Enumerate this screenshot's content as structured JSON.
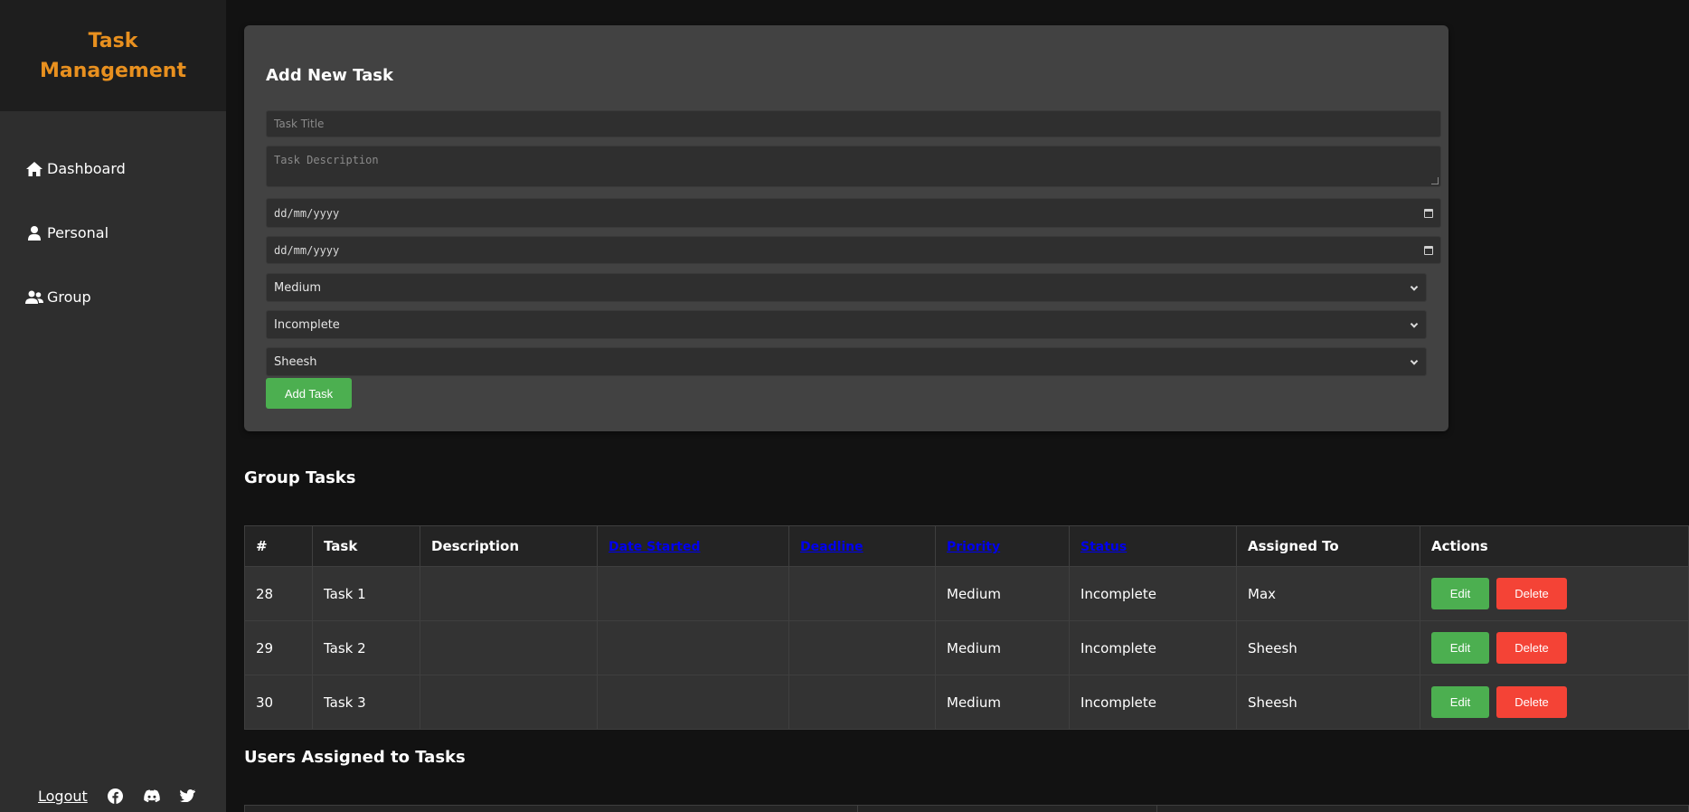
{
  "sidebar": {
    "brand": "Task Management",
    "items": [
      {
        "label": "Dashboard",
        "icon": "home-icon"
      },
      {
        "label": "Personal",
        "icon": "user-icon"
      },
      {
        "label": "Group",
        "icon": "users-icon"
      }
    ],
    "footer": {
      "logout_label": "Logout",
      "social": [
        "facebook-icon",
        "discord-icon",
        "twitter-icon"
      ]
    }
  },
  "form": {
    "title": "Add New Task",
    "title_placeholder": "Task Title",
    "description_placeholder": "Task Description",
    "date_started_placeholder": "dd/mm/yyyy",
    "deadline_placeholder": "dd/mm/yyyy",
    "priority_value": "Medium",
    "status_value": "Incomplete",
    "assignee_value": "Sheesh",
    "submit_label": "Add Task"
  },
  "group_tasks": {
    "title": "Group Tasks",
    "columns": [
      "#",
      "Task",
      "Description",
      "Date Started",
      "Deadline",
      "Priority",
      "Status",
      "Assigned To",
      "Actions"
    ],
    "rows": [
      {
        "id": "28",
        "task": "Task 1",
        "description": "",
        "date_started": "",
        "deadline": "",
        "priority": "Medium",
        "status": "Incomplete",
        "assigned_to": "Max"
      },
      {
        "id": "29",
        "task": "Task 2",
        "description": "",
        "date_started": "",
        "deadline": "",
        "priority": "Medium",
        "status": "Incomplete",
        "assigned_to": "Sheesh"
      },
      {
        "id": "30",
        "task": "Task 3",
        "description": "",
        "date_started": "",
        "deadline": "",
        "priority": "Medium",
        "status": "Incomplete",
        "assigned_to": "Sheesh"
      }
    ],
    "edit_label": "Edit",
    "delete_label": "Delete"
  },
  "users_section": {
    "title": "Users Assigned to Tasks"
  },
  "colors": {
    "brand": "#e8901f",
    "primary": "#4caf50",
    "danger": "#f44336",
    "link": "#0000ee"
  }
}
